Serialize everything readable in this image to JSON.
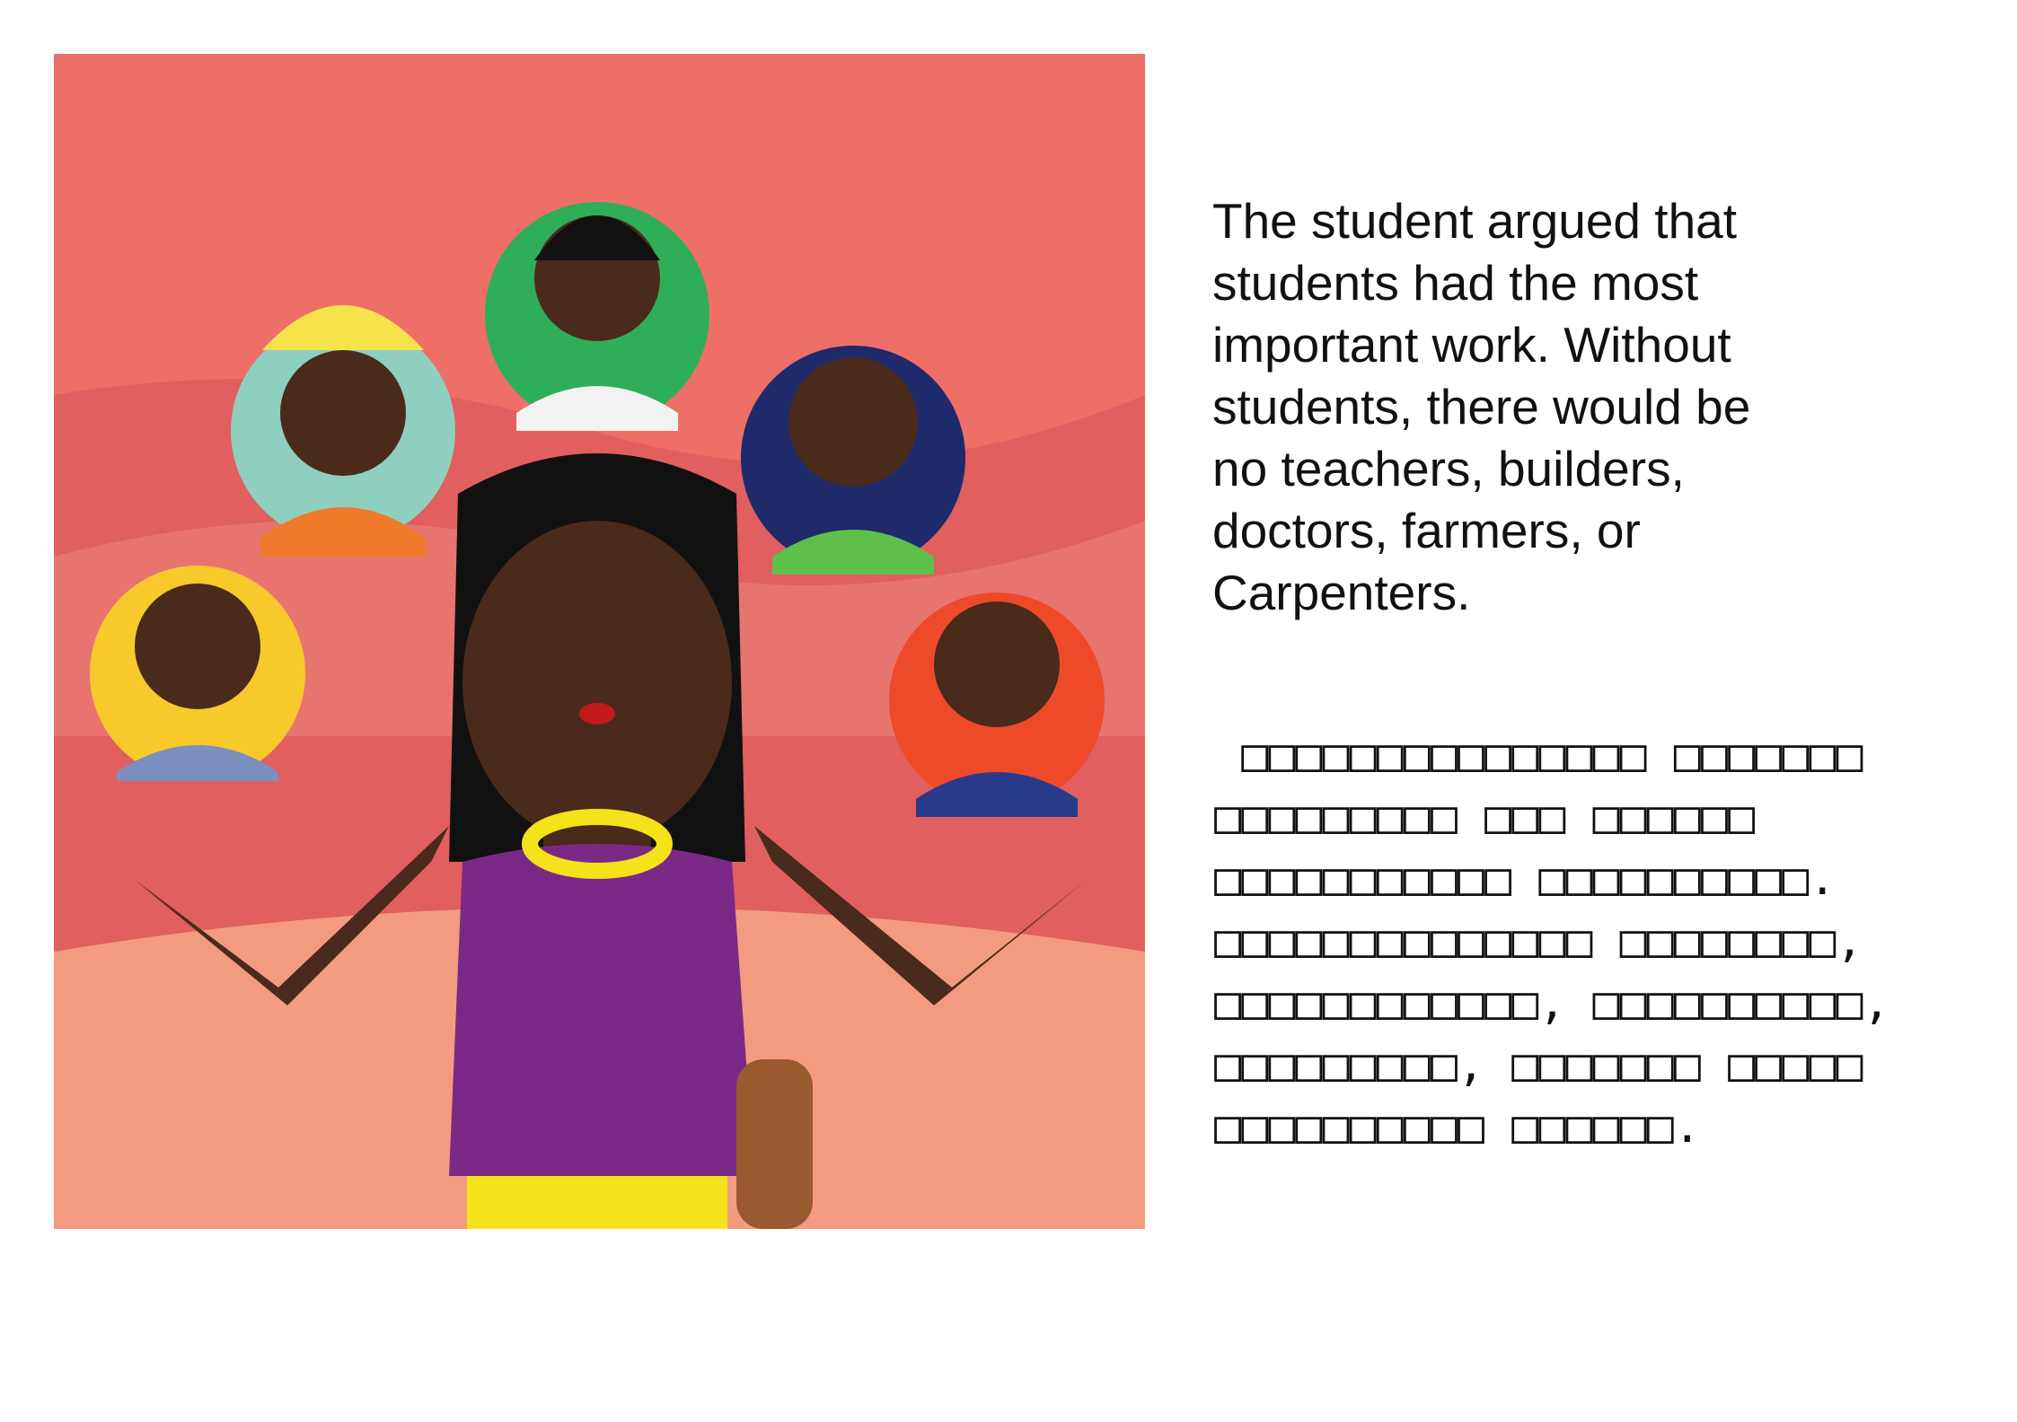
{
  "illustration": {
    "description_label": "student-and-professions",
    "colors": {
      "background": "#ee6f68",
      "dress": "#7a2a86",
      "skin": "#4a2a1a"
    }
  },
  "text": {
    "english": " The student argued that\nstudents had the most\nimportant work.  Without\nstudents, there would be\nno teachers, builders,\ndoctors, farmers, or\nCarpenters.",
    "translation": " □□□□□□□□□□□□□□□ □□□□□□□\n□□□□□□□□□ □□□ □□□□□□\n□□□□□□□□□□□ □□□□□□□□□□.\n□□□□□□□□□□□□□□ □□□□□□□□,\n□□□□□□□□□□□□, □□□□□□□□□□,\n□□□□□□□□□, □□□□□□□ □□□□□\n□□□□□□□□□□ □□□□□□."
  }
}
